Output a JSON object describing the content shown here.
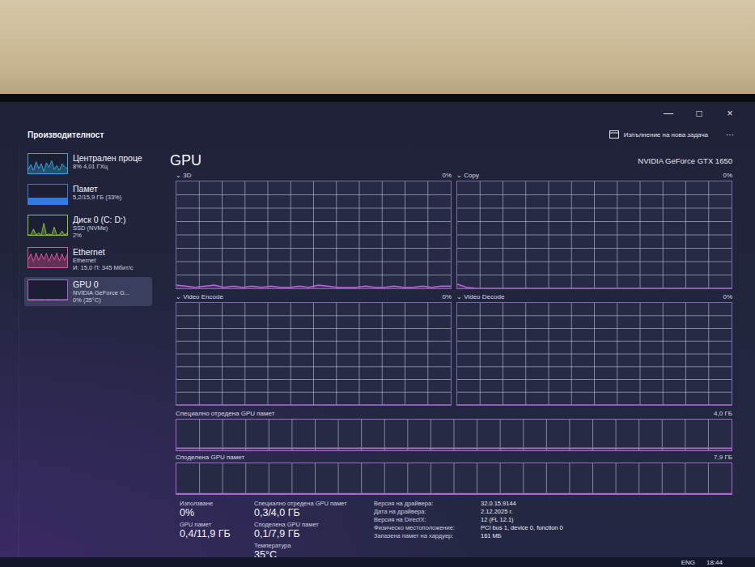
{
  "window": {
    "title": "Производителност",
    "controls": [
      "—",
      "□",
      "×"
    ],
    "action": "Изпълнение на нова задача",
    "more": "···"
  },
  "sidebar": {
    "items": [
      {
        "name": "Централен проце",
        "details": [
          "8% 4,01 ГХц"
        ],
        "selected": false,
        "kind": "line",
        "color": "#3aa6e0",
        "values": [
          20,
          45,
          15,
          60,
          25,
          50,
          10,
          55,
          30,
          65,
          20,
          40,
          15,
          50,
          35,
          25
        ]
      },
      {
        "name": "Памет",
        "details": [
          "5,2/15,9 ГБ (33%)"
        ],
        "selected": false,
        "kind": "fill",
        "color": "#2f7de0",
        "level": 0.33
      },
      {
        "name": "Диск 0 (C: D:)",
        "details": [
          "SSD (NVMe)",
          "2%"
        ],
        "selected": false,
        "kind": "line",
        "color": "#8cc63f",
        "values": [
          0,
          0,
          30,
          0,
          10,
          0,
          60,
          0,
          5,
          0,
          40,
          0,
          0,
          20,
          0,
          10
        ]
      },
      {
        "name": "Ethernet",
        "details": [
          "Ethernet",
          "И: 15,0 П: 345 Мбит/с"
        ],
        "selected": false,
        "kind": "line",
        "color": "#e0559a",
        "values": [
          40,
          70,
          30,
          75,
          35,
          70,
          40,
          72,
          30,
          68,
          38,
          74,
          32,
          70,
          36,
          66
        ]
      },
      {
        "name": "GPU 0",
        "details": [
          "NVIDIA GeForce G...",
          "0% (35°C)"
        ],
        "selected": true,
        "kind": "line",
        "color": "#b45ad0",
        "values": [
          2,
          1,
          2,
          1,
          1,
          2,
          1,
          1,
          2,
          1,
          1,
          2,
          1,
          1,
          1,
          1
        ]
      }
    ]
  },
  "gpu": {
    "title": "GPU",
    "name": "NVIDIA GeForce GTX 1650",
    "engines": [
      {
        "label": "3D",
        "reading": "0%",
        "max": 100,
        "values": [
          3,
          2,
          1,
          2,
          3,
          1,
          2,
          1,
          2,
          1,
          2,
          1,
          1,
          2,
          1,
          3,
          2,
          1,
          1,
          1,
          2,
          1,
          1,
          2,
          1,
          1,
          2,
          1,
          2,
          2
        ]
      },
      {
        "label": "Copy",
        "reading": "0%",
        "max": 100,
        "values": [
          4,
          1,
          0,
          0,
          0,
          0,
          0,
          0,
          0,
          0,
          0,
          0,
          0,
          0,
          0,
          0,
          0,
          0,
          0,
          0,
          0,
          0,
          0,
          0,
          0,
          0,
          0,
          0,
          0,
          0
        ]
      },
      {
        "label": "Video Encode",
        "reading": "0%",
        "max": 100,
        "values": [
          0,
          0,
          0,
          0,
          0,
          0,
          0,
          0,
          0,
          0,
          0,
          0,
          0,
          0,
          0,
          0,
          0,
          0,
          0,
          0,
          0,
          0,
          0,
          0,
          0,
          0,
          0,
          0,
          0,
          0
        ]
      },
      {
        "label": "Video Decode",
        "reading": "0%",
        "max": 100,
        "values": [
          0,
          0,
          0,
          0,
          0,
          0,
          0,
          0,
          0,
          0,
          0,
          0,
          0,
          0,
          0,
          0,
          0,
          0,
          0,
          0,
          0,
          0,
          0,
          0,
          0,
          0,
          0,
          0,
          0,
          0
        ]
      }
    ],
    "memory_charts": [
      {
        "label": "Специално отредена GPU памет",
        "max_label": "4,0 ГБ",
        "max": 4.0,
        "values": [
          0.3,
          0.3,
          0.3,
          0.3,
          0.3,
          0.3,
          0.3,
          0.3,
          0.3,
          0.3,
          0.3,
          0.3,
          0.3,
          0.3,
          0.3,
          0.3,
          0.3,
          0.3,
          0.3,
          0.3
        ]
      },
      {
        "label": "Споделена GPU памет",
        "max_label": "7,9 ГБ",
        "max": 7.9,
        "values": [
          0.1,
          0.1,
          0.1,
          0.1,
          0.1,
          0.1,
          0.1,
          0.1,
          0.1,
          0.1,
          0.1,
          0.1,
          0.1,
          0.1,
          0.1,
          0.1,
          0.1,
          0.1,
          0.1,
          0.1
        ]
      }
    ],
    "stat_columns": [
      [
        {
          "label": "Използване",
          "value": "0%"
        },
        {
          "label": "GPU памет",
          "value": "0,4/11,9 ГБ"
        }
      ],
      [
        {
          "label": "Специално отредена GPU памет",
          "value": "0,3/4,0 ГБ"
        },
        {
          "label": "Споделена GPU памет",
          "value": "0,1/7,9 ГБ"
        },
        {
          "label": "Температура",
          "value": "35°C"
        }
      ]
    ],
    "info": [
      {
        "label": "Версия на драйвера:",
        "value": "32.0.15.9144"
      },
      {
        "label": "Дата на драйвера:",
        "value": "2.12.2025 г."
      },
      {
        "label": "Версия на DirectX:",
        "value": "12 (FL 12.1)"
      },
      {
        "label": "Физическо местоположение:",
        "value": "PCI bus 1, device 0, function 0"
      },
      {
        "label": "Запазена памет на хардуер:",
        "value": "161 МБ"
      }
    ]
  },
  "taskbar": {
    "language": "ENG",
    "time": "18:44"
  }
}
